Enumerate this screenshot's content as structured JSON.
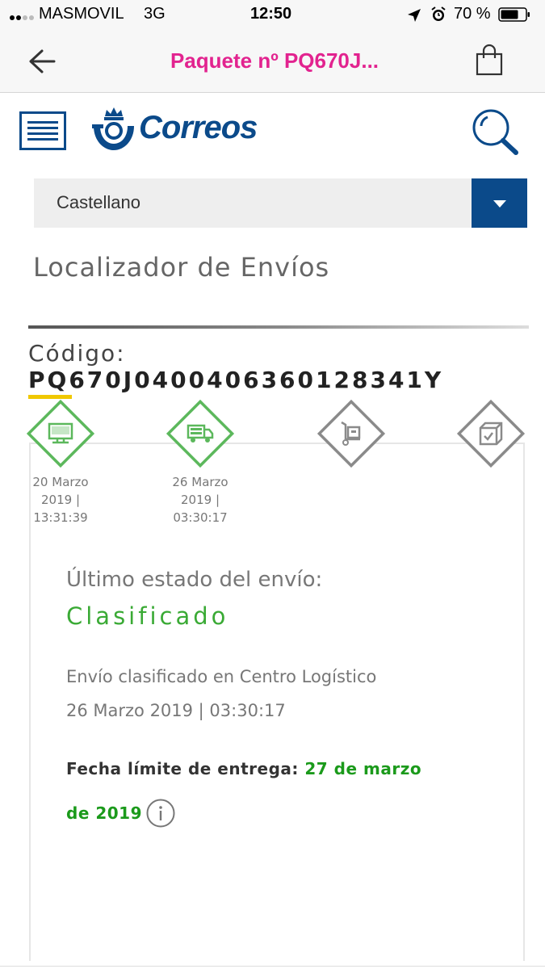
{
  "status_bar": {
    "carrier": "MASMOVIL",
    "network": "3G",
    "time": "12:50",
    "battery": "70 %"
  },
  "nav": {
    "title": "Paquete nº PQ670J...",
    "back_icon": "back-arrow-icon",
    "bag_icon": "shopping-bag-icon"
  },
  "header": {
    "menu_icon": "menu-icon",
    "logo_text": "Correos",
    "search_icon": "search-icon"
  },
  "language": {
    "selected": "Castellano"
  },
  "page": {
    "title": "Localizador de Envíos",
    "code_label": "Código:",
    "code_value": "PQ670J0400406360128341Y"
  },
  "tracking": {
    "steps": [
      {
        "icon": "computer-icon",
        "state": "done",
        "date_line1": "20 Marzo",
        "date_line2": "2019 |",
        "date_line3": "13:31:39"
      },
      {
        "icon": "truck-icon",
        "state": "done",
        "date_line1": "26 Marzo",
        "date_line2": "2019 |",
        "date_line3": "03:30:17"
      },
      {
        "icon": "hand-truck-icon",
        "state": "pending"
      },
      {
        "icon": "package-icon",
        "state": "pending"
      }
    ],
    "last_state_label": "Último estado del envío:",
    "last_state": "Clasificado",
    "description": "Envío clasificado en Centro Logístico",
    "description_date": "26 Marzo 2019 | 03:30:17",
    "deadline_label": "Fecha límite de entrega:",
    "deadline_part1": "27 de marzo",
    "deadline_part2": "de 2019"
  },
  "colors": {
    "accent_pink": "#e2238f",
    "correos_blue": "#0b4a8a",
    "done_green": "#5cb85c",
    "status_green": "#3aaa35",
    "pending_gray": "#8a8a8a"
  }
}
